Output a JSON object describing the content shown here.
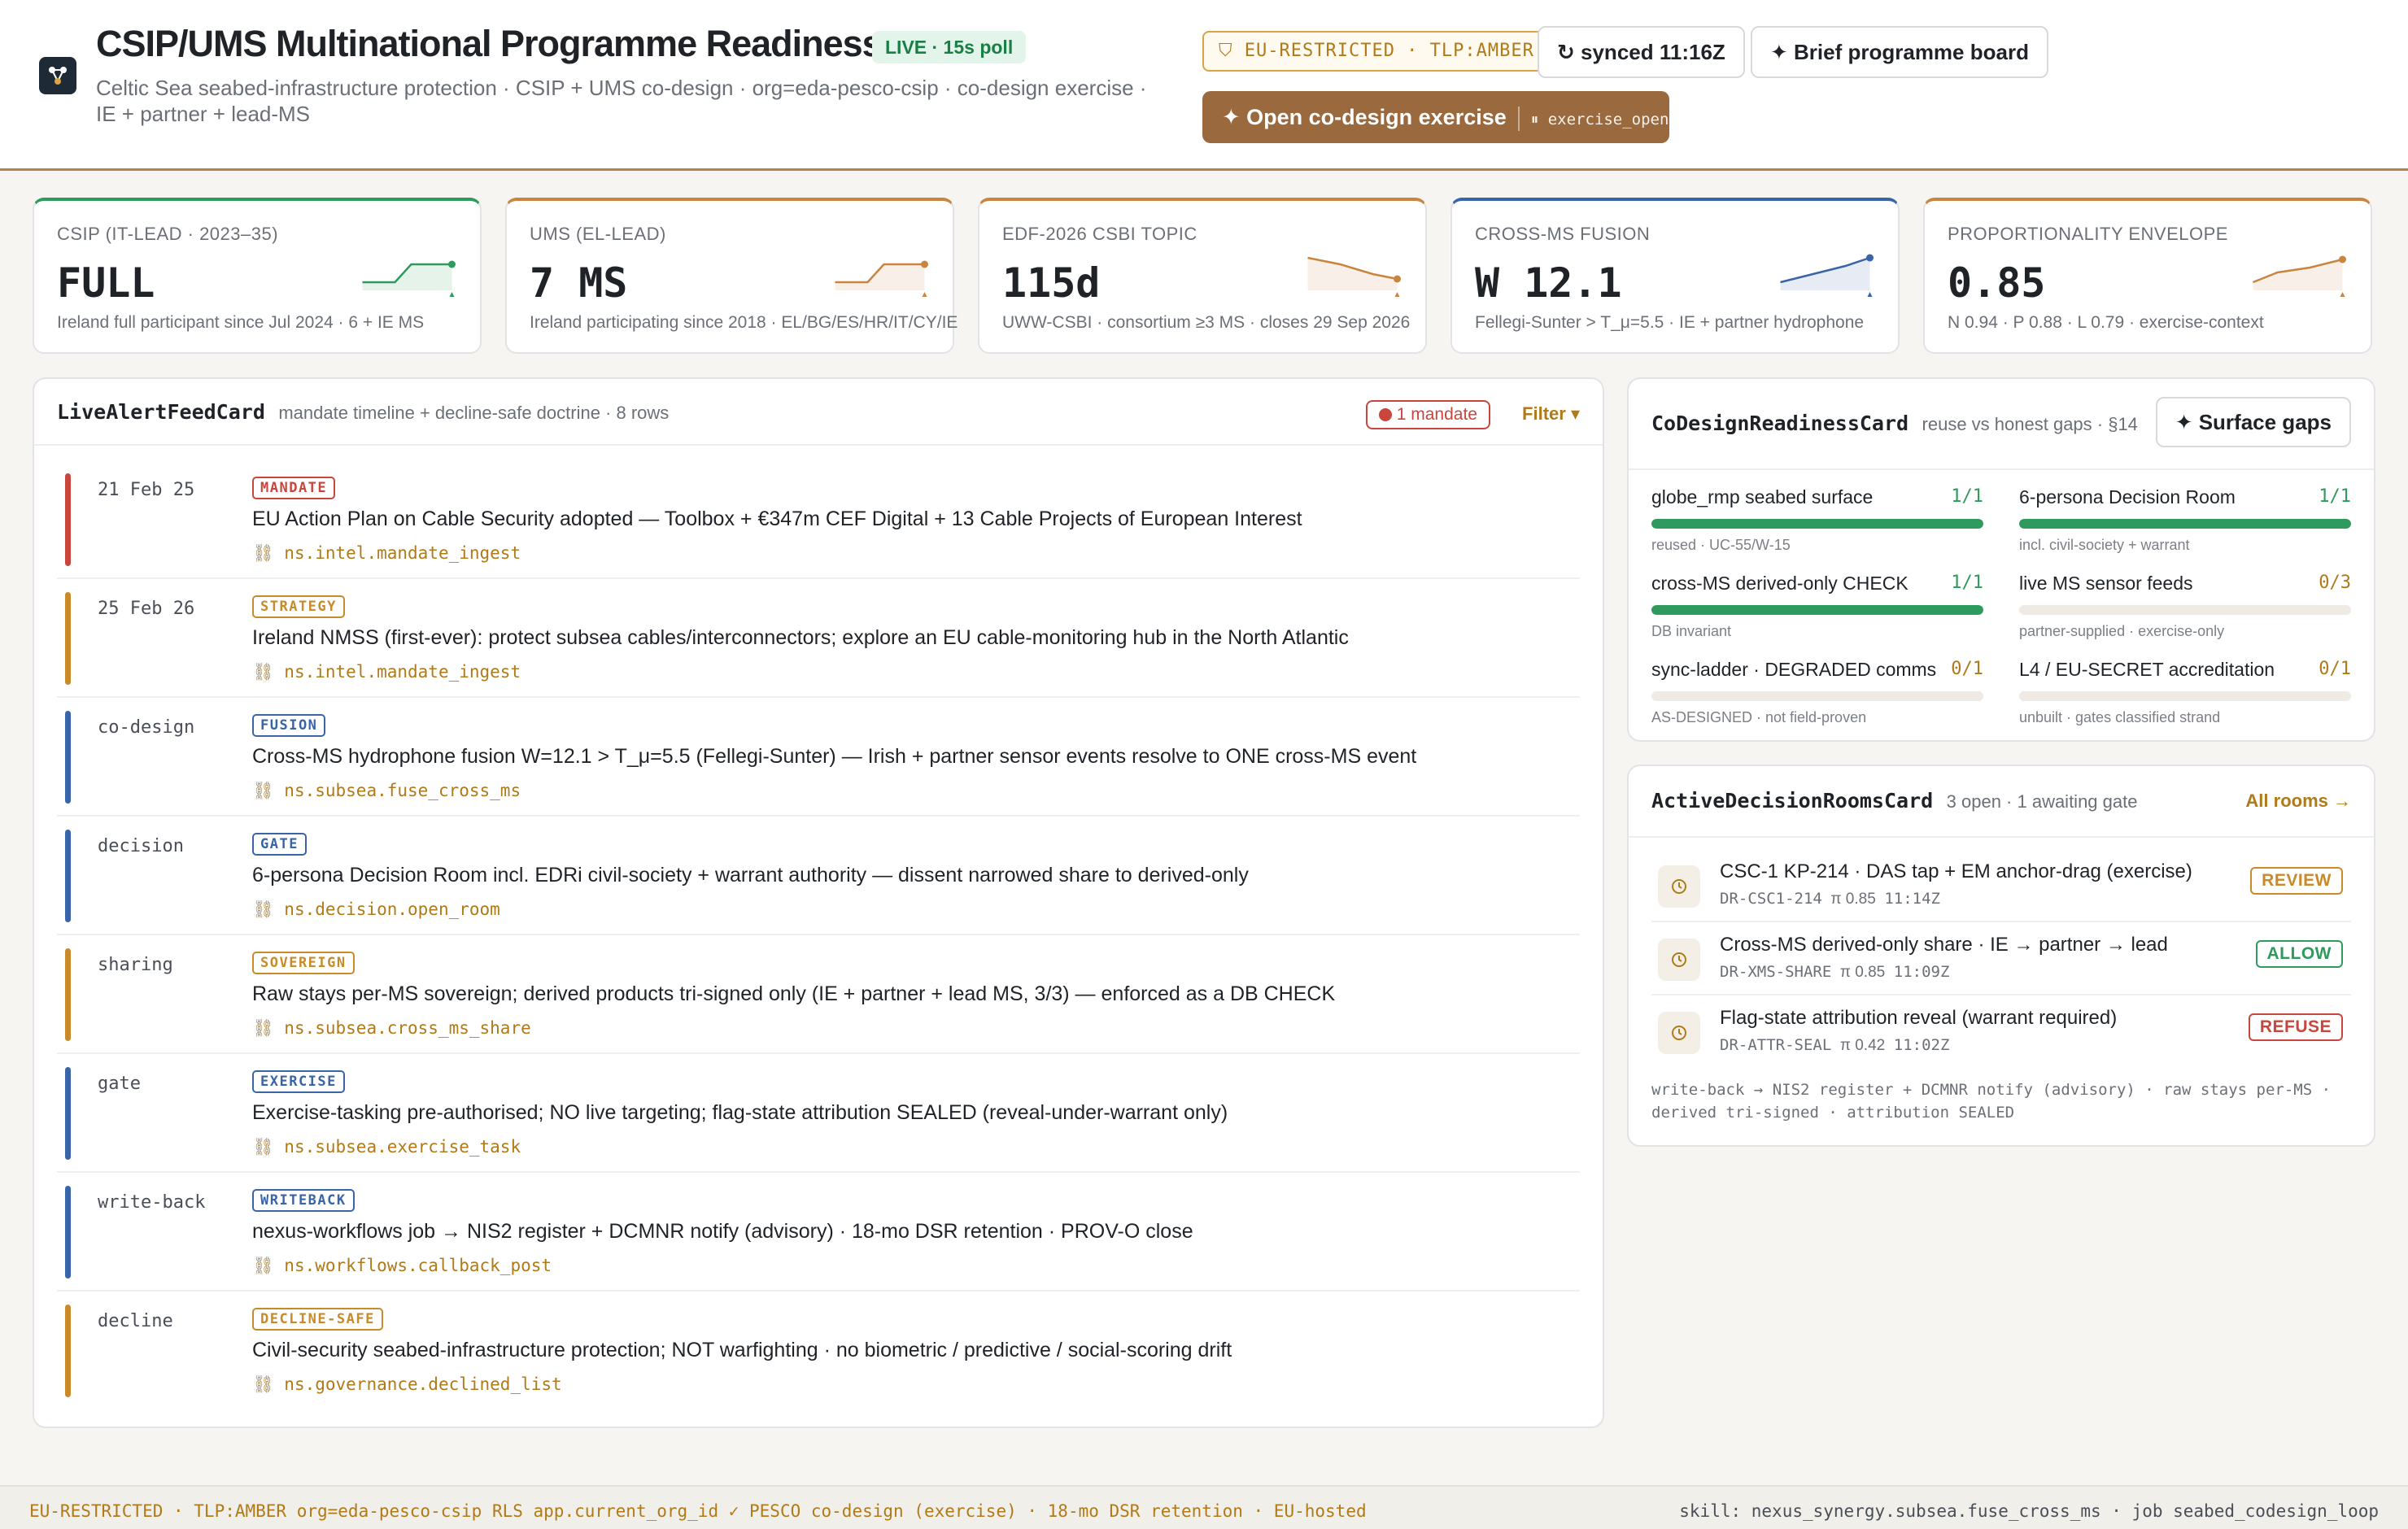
{
  "header": {
    "title": "CSIP/UMS Multinational Programme Readiness",
    "live_badge": "LIVE · 15s poll",
    "subtitle": "Celtic Sea seabed-infrastructure protection · CSIP + UMS co-design · org=eda-pesco-csip · co-design exercise · IE + partner + lead-MS",
    "tlp_badge": "EU-RESTRICTED · TLP:AMBER",
    "synced": "synced 11:16Z",
    "brief_button": "Brief programme board",
    "primary_button": "Open co-design exercise",
    "primary_button_code": "exercise_open"
  },
  "kpis": [
    {
      "label": "CSIP (IT-LEAD · 2023–35)",
      "value": "FULL",
      "sub": "Ireland full participant since Jul 2024 · 6 + IE MS",
      "color": "#2f9a5d"
    },
    {
      "label": "UMS (EL-LEAD)",
      "value": "7 MS",
      "sub": "Ireland participating since 2018 · EL/BG/ES/HR/IT/CY/IE",
      "color": "#c9853f"
    },
    {
      "label": "EDF-2026 CSBI TOPIC",
      "value": "115d",
      "sub": "UWW-CSBI · consortium ≥3 MS · closes 29 Sep 2026",
      "color": "#c9853f"
    },
    {
      "label": "CROSS-MS FUSION",
      "value": "W 12.1",
      "sub": "Fellegi-Sunter > T_μ=5.5 · IE + partner hydrophone",
      "color": "#3a64a8"
    },
    {
      "label": "PROPORTIONALITY ENVELOPE",
      "value": "0.85",
      "sub": "N 0.94 · P 0.88 · L 0.79 · exercise-context",
      "color": "#c9853f"
    }
  ],
  "feed": {
    "title": "LiveAlertFeedCard",
    "meta": "mandate timeline + decline-safe doctrine · 8 rows",
    "mandate_pill": "1 mandate",
    "filter": "Filter ▾",
    "rows": [
      {
        "key": "21 Feb 25",
        "badge": "MANDATE",
        "text": "EU Action Plan on Cable Security adopted — Toolbox + €347m CEF Digital + 13 Cable Projects of European Interest",
        "code": "⛓ ns.intel.mandate_ingest",
        "color": "#c9463d"
      },
      {
        "key": "25 Feb 26",
        "badge": "STRATEGY",
        "text": "Ireland NMSS (first-ever): protect subsea cables/interconnectors; explore an EU cable-monitoring hub in the North Atlantic",
        "code": "⛓ ns.intel.mandate_ingest",
        "color": "#c98a2a"
      },
      {
        "key": "co-design",
        "badge": "FUSION",
        "text": "Cross-MS hydrophone fusion W=12.1 > T_μ=5.5 (Fellegi-Sunter) — Irish + partner sensor events resolve to ONE cross-MS event",
        "code": "⛓ ns.subsea.fuse_cross_ms",
        "color": "#3a64a8"
      },
      {
        "key": "decision",
        "badge": "GATE",
        "text": "6-persona Decision Room incl. EDRi civil-society + warrant authority — dissent narrowed share to derived-only",
        "code": "⛓ ns.decision.open_room",
        "color": "#3a64a8"
      },
      {
        "key": "sharing",
        "badge": "SOVEREIGN",
        "text": "Raw stays per-MS sovereign; derived products tri-signed only (IE + partner + lead MS, 3/3) — enforced as a DB CHECK",
        "code": "⛓ ns.subsea.cross_ms_share",
        "color": "#c98a2a"
      },
      {
        "key": "gate",
        "badge": "EXERCISE",
        "text": "Exercise-tasking pre-authorised; NO live targeting; flag-state attribution SEALED (reveal-under-warrant only)",
        "code": "⛓ ns.subsea.exercise_task",
        "color": "#3a64a8"
      },
      {
        "key": "write-back",
        "badge": "WRITEBACK",
        "text": "nexus-workflows job → NIS2 register + DCMNR notify (advisory) · 18-mo DSR retention · PROV-O close",
        "code": "⛓ ns.workflows.callback_post",
        "color": "#3a64a8"
      },
      {
        "key": "decline",
        "badge": "DECLINE-SAFE",
        "text": "Civil-security seabed-infrastructure protection; NOT warfighting · no biometric / predictive / social-scoring drift",
        "code": "⛓ ns.governance.declined_list",
        "color": "#c98a2a"
      }
    ]
  },
  "readiness": {
    "title": "CoDesignReadinessCard",
    "meta": "reuse vs honest gaps · §14",
    "button": "Surface gaps",
    "items": [
      {
        "name": "globe_rmp seabed surface",
        "count": "1/1",
        "note": "reused · UC-55/W-15",
        "progress": 1.0
      },
      {
        "name": "6-persona Decision Room",
        "count": "1/1",
        "note": "incl. civil-society + warrant",
        "progress": 1.0
      },
      {
        "name": "cross-MS derived-only CHECK",
        "count": "1/1",
        "note": "DB invariant",
        "progress": 1.0
      },
      {
        "name": "live MS sensor feeds",
        "count": "0/3",
        "note": "partner-supplied · exercise-only",
        "progress": 0.0
      },
      {
        "name": "sync-ladder · DEGRADED comms",
        "count": "0/1",
        "note": "AS-DESIGNED · not field-proven",
        "progress": 0.0
      },
      {
        "name": "L4 / EU-SECRET accreditation",
        "count": "0/1",
        "note": "unbuilt · gates classified strand",
        "progress": 0.0
      }
    ]
  },
  "rooms": {
    "title": "ActiveDecisionRoomsCard",
    "meta": "3 open · 1 awaiting gate",
    "link": "All rooms →",
    "items": [
      {
        "title": "CSC-1 KP-214 · DAS tap + EM anchor-drag (exercise)",
        "id": "DR-CSC1-214",
        "pi": "π 0.85",
        "time": "11:14Z",
        "status": "REVIEW",
        "color": "#c98a2a"
      },
      {
        "title": "Cross-MS derived-only share · IE → partner → lead",
        "id": "DR-XMS-SHARE",
        "pi": "π 0.85",
        "time": "11:09Z",
        "status": "ALLOW",
        "color": "#2f9a5d"
      },
      {
        "title": "Flag-state attribution reveal (warrant required)",
        "id": "DR-ATTR-SEAL",
        "pi": "π 0.42",
        "time": "11:02Z",
        "status": "REFUSE",
        "color": "#c9463d"
      }
    ],
    "footnote": "write-back → NIS2 register + DCMNR notify (advisory) · raw stays per-MS · derived tri-signed · attribution SEALED"
  },
  "footer": {
    "left": "EU-RESTRICTED · TLP:AMBER   org=eda-pesco-csip   RLS app.current_org_id ✓   PESCO co-design (exercise) · 18-mo DSR retention · EU-hosted",
    "right": "skill: nexus_synergy.subsea.fuse_cross_ms · job seabed_codesign_loop"
  },
  "icons": {
    "logo": "network-nodes-icon",
    "synced": "refresh-icon",
    "brief": "sparkle-icon",
    "primary": "sparkle-icon",
    "tlp": "shield-icon",
    "code": "link-icon",
    "room": "clock-icon"
  }
}
